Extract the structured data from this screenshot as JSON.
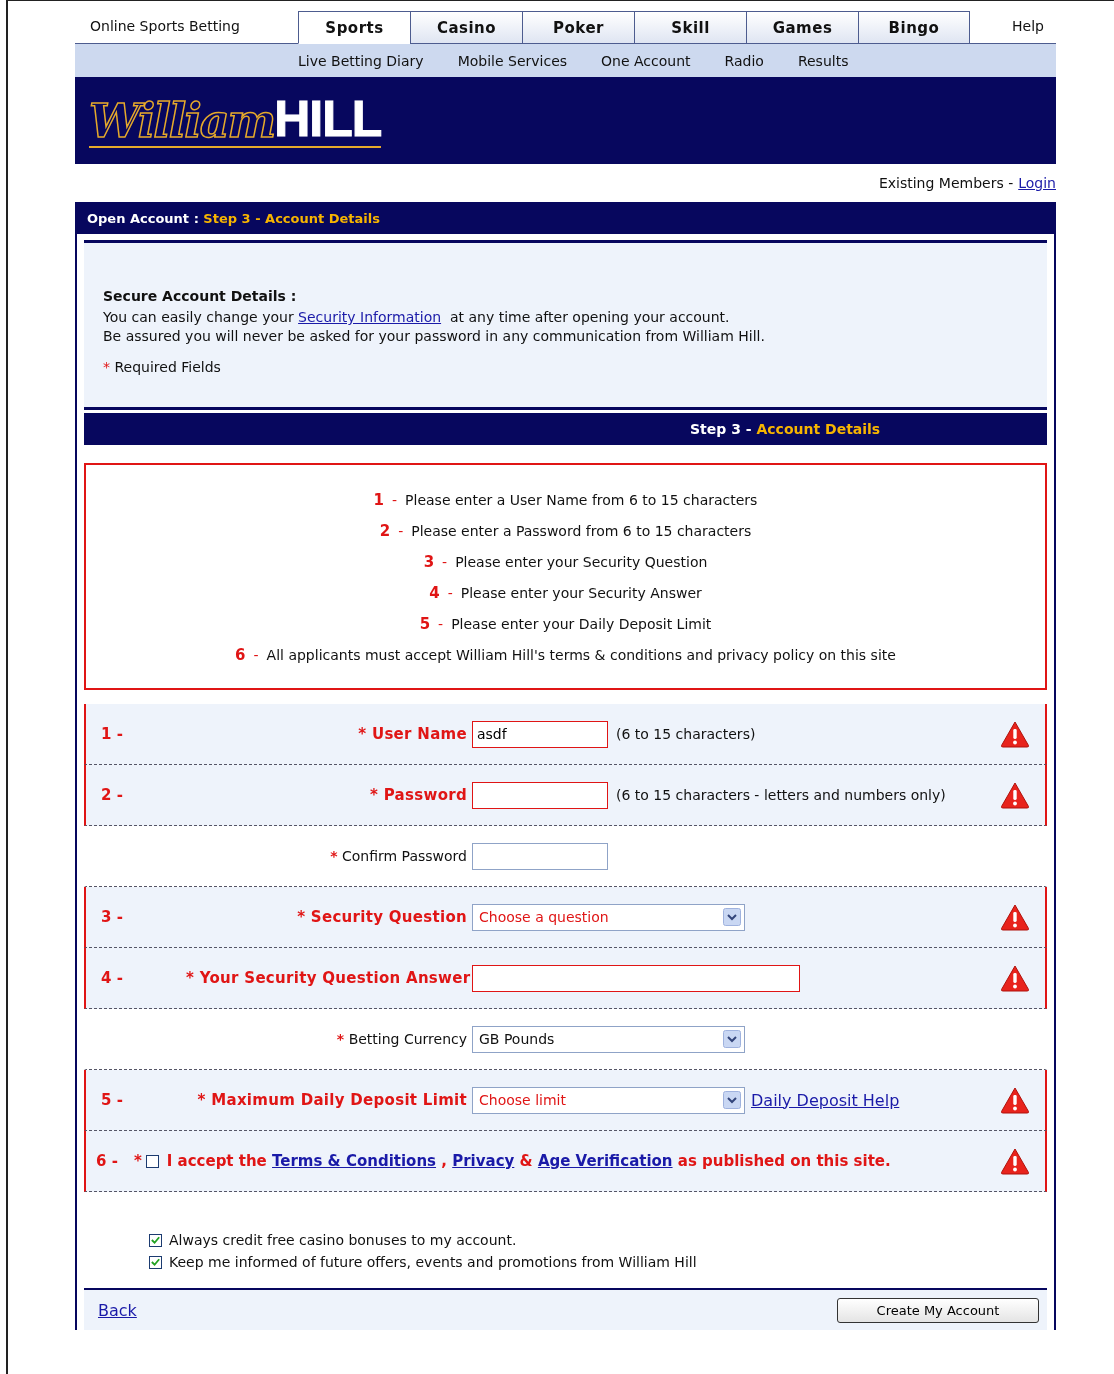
{
  "top_nav": {
    "site_label": "Online Sports Betting",
    "help": "Help",
    "tabs": [
      {
        "label": "Sports",
        "selected": true
      },
      {
        "label": "Casino",
        "selected": false
      },
      {
        "label": "Poker",
        "selected": false
      },
      {
        "label": "Skill",
        "selected": false
      },
      {
        "label": "Games",
        "selected": false
      },
      {
        "label": "Bingo",
        "selected": false
      }
    ]
  },
  "sub_nav": [
    "Live Betting Diary",
    "Mobile Services",
    "One Account",
    "Radio",
    "Results"
  ],
  "logo": {
    "script": "William",
    "block": "HILL"
  },
  "login_bar": {
    "prefix": "Existing Members -",
    "link": "Login"
  },
  "breadcrumb": {
    "label": "Open Account",
    "separator": ":",
    "step": "Step 3 - Account Details"
  },
  "intro": {
    "heading": "Secure Account Details :",
    "before_link": "You can easily change your",
    "link": "Security Information",
    "after_link": "at any time after opening your account.",
    "line2": "Be assured you will never be asked for your password in any communication from William Hill.",
    "required_mark": "*",
    "required_text": "Required Fields"
  },
  "step_bar": {
    "step": "Step 3 -",
    "title": "Account Details"
  },
  "errors": [
    {
      "number": "1",
      "dash": "-",
      "text": "Please enter a User Name from 6 to 15 characters"
    },
    {
      "number": "2",
      "dash": "-",
      "text": "Please enter a Password from 6 to 15 characters"
    },
    {
      "number": "3",
      "dash": "-",
      "text": "Please enter your Security Question"
    },
    {
      "number": "4",
      "dash": "-",
      "text": "Please enter your Security Answer"
    },
    {
      "number": "5",
      "dash": "-",
      "text": "Please enter your Daily Deposit Limit"
    },
    {
      "number": "6",
      "dash": "-",
      "text": "All applicants must accept William Hill's terms & conditions and privacy policy on this site"
    }
  ],
  "form_rows": [
    {
      "kind": "input",
      "number": "1 -",
      "mark": "*",
      "label": "User Name",
      "value": "asdf",
      "hint": "(6 to 15 characters)",
      "error": true
    },
    {
      "kind": "input",
      "number": "2 -",
      "mark": "*",
      "label": "Password",
      "hint": "(6 to 15 characters - letters and numbers only)",
      "error": true
    },
    {
      "kind": "input",
      "mark": "*",
      "label": "Confirm Password",
      "error": false
    },
    {
      "kind": "select",
      "number": "3 -",
      "mark": "*",
      "label": "Security Question",
      "value": "Choose a question",
      "error": true
    },
    {
      "kind": "long_input",
      "number": "4 -",
      "mark": "*",
      "label": "Your Security Question Answer",
      "error": true
    },
    {
      "kind": "select",
      "mark": "*",
      "label": "Betting Currency",
      "value": "GB Pounds",
      "error": false
    },
    {
      "kind": "select",
      "number": "5 -",
      "mark": "*",
      "label": "Maximum Daily Deposit Limit",
      "value": "Choose limit",
      "link": "Daily Deposit Help",
      "error": true
    },
    {
      "kind": "terms",
      "number": "6 -",
      "mark": "*",
      "checked": false,
      "error": true,
      "parts": [
        {
          "kind": "text",
          "text": "I accept the"
        },
        {
          "kind": "link",
          "text": "Terms & Conditions"
        },
        {
          "kind": "text",
          "text": ","
        },
        {
          "kind": "link",
          "text": "Privacy"
        },
        {
          "kind": "text",
          "text": "&"
        },
        {
          "kind": "link",
          "text": "Age Verification"
        },
        {
          "kind": "text",
          "text": "as published on this site."
        }
      ]
    }
  ],
  "options": [
    {
      "label": "Always credit free casino bonuses to my account.",
      "checked": true
    },
    {
      "label": "Keep me informed of future offers, events and promotions from William Hill",
      "checked": true
    }
  ],
  "footer": {
    "back": "Back",
    "submit": "Create My Account"
  }
}
